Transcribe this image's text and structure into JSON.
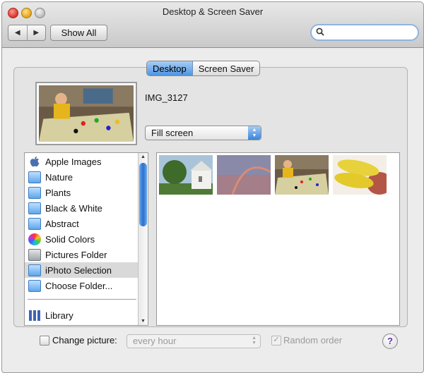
{
  "window": {
    "title": "Desktop & Screen Saver",
    "show_all_label": "Show All",
    "search_placeholder": ""
  },
  "tabs": [
    {
      "label": "Desktop",
      "active": true
    },
    {
      "label": "Screen Saver",
      "active": false
    }
  ],
  "current": {
    "image_name": "IMG_3127",
    "fit_mode": "Fill screen"
  },
  "sources": [
    {
      "label": "Apple Images",
      "icon": "apple-icon"
    },
    {
      "label": "Nature",
      "icon": "folder-icon"
    },
    {
      "label": "Plants",
      "icon": "folder-icon"
    },
    {
      "label": "Black & White",
      "icon": "folder-icon"
    },
    {
      "label": "Abstract",
      "icon": "folder-icon"
    },
    {
      "label": "Solid Colors",
      "icon": "color-wheel-icon"
    },
    {
      "label": "Pictures Folder",
      "icon": "pictures-folder-icon"
    },
    {
      "label": "iPhoto Selection",
      "icon": "folder-icon",
      "selected": true
    },
    {
      "label": "Choose Folder...",
      "icon": "folder-icon"
    },
    {
      "label": "Library",
      "icon": "library-icon"
    }
  ],
  "thumbnails": [
    {
      "subject": "house-tree-photo"
    },
    {
      "subject": "rainbow-photo"
    },
    {
      "subject": "child-table-photo"
    },
    {
      "subject": "corn-photo"
    }
  ],
  "options": {
    "change_picture_label": "Change picture:",
    "change_picture_checked": false,
    "interval": "every hour",
    "random_order_label": "Random order",
    "random_order_checked": true,
    "help_label": "?"
  },
  "colors": {
    "selection_blue": "#4e95e3",
    "help_purple": "#6a2bb5"
  }
}
